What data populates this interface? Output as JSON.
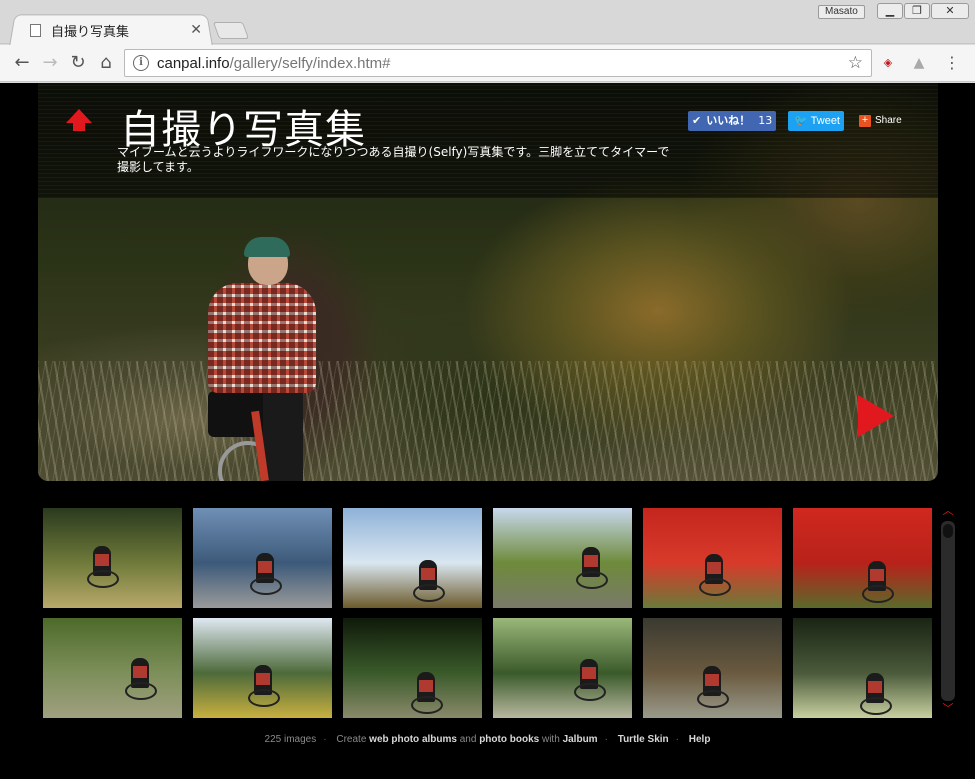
{
  "browser": {
    "tab_title": "自撮り写真集",
    "profile_name": "Masato",
    "url_host": "canpal.info",
    "url_path": "/gallery/selfy/index.htm#",
    "icons": {
      "back": "back-arrow-icon",
      "forward": "forward-arrow-icon",
      "reload": "reload-icon",
      "home": "home-icon",
      "info": "info-icon",
      "star": "bookmark-star-icon",
      "menu": "menu-dots-icon"
    }
  },
  "header": {
    "title": "自撮り写真集",
    "description": "マイブームと云うよりライフワークになりつつある自撮り(Selfy)写真集です。三脚を立ててタイマーで撮影してます。",
    "like_label": "いいね！",
    "like_count": "13",
    "tweet_label": "Tweet",
    "share_label": "Share"
  },
  "thumbnails": [
    {
      "colors": [
        "#2a3a1e",
        "#6f7a3a",
        "#b8a96a"
      ]
    },
    {
      "colors": [
        "#6f8fb5",
        "#3d5a7a",
        "#9a9a9a"
      ]
    },
    {
      "colors": [
        "#8fb2d8",
        "#d9e6f0",
        "#6b5a2c"
      ]
    },
    {
      "colors": [
        "#c8d8ec",
        "#6e8a3a",
        "#7a7a6a"
      ]
    },
    {
      "colors": [
        "#c4261e",
        "#d83a2a",
        "#6a7a3a"
      ]
    },
    {
      "colors": [
        "#d0281e",
        "#b8221a",
        "#5a6a2a"
      ]
    },
    {
      "colors": [
        "#4d6a2a",
        "#7d8f5a",
        "#a0a080"
      ]
    },
    {
      "colors": [
        "#dfe8f2",
        "#4d6a3a",
        "#c8b040"
      ]
    },
    {
      "colors": [
        "#0f1a0a",
        "#3a5a2a",
        "#8a8a6a"
      ]
    },
    {
      "colors": [
        "#9ab87a",
        "#3a5a2a",
        "#b8b8a0"
      ]
    },
    {
      "colors": [
        "#3a3a30",
        "#6a5a40",
        "#9a9a8a"
      ]
    },
    {
      "colors": [
        "#1a2414",
        "#4a5a3a",
        "#c8d0a0"
      ]
    }
  ],
  "footer": {
    "count": "225 images",
    "create": "Create",
    "web_albums": "web photo albums",
    "and": "and",
    "photo_books": "photo books",
    "with": "with",
    "jalbum": "Jalbum",
    "skin": "Turtle Skin",
    "help": "Help"
  },
  "colors": {
    "accent": "#e1191e",
    "facebook": "#4267b2",
    "twitter": "#1da1f2"
  }
}
